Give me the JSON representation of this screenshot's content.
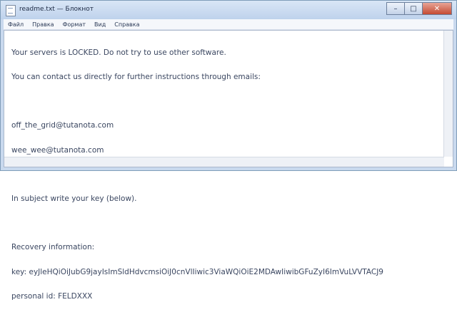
{
  "window": {
    "title": "readme.txt — Блокнот"
  },
  "menu": {
    "items": [
      "Файл",
      "Правка",
      "Формат",
      "Вид",
      "Справка"
    ]
  },
  "document": {
    "lines": [
      "Your servers is LOCKED. Do not try to use other software.",
      "You can contact us directly for further instructions through emails:",
      "",
      "off_the_grid@tutanota.com",
      "wee_wee@tutanota.com",
      "",
      "In subject write your key (below).",
      "",
      "Recovery information:",
      "key: eyJleHQiOiJubG9jayIsImSldHdvcmsiOiJ0cnVlIiwic3ViaWQiOiE2MDAwIiwibGFuZyI6ImVuLVVTACJ9",
      "personal id: FELDXXX"
    ]
  },
  "icons": {
    "app": "notepad-icon",
    "minimize": "minimize-icon",
    "maximize": "maximize-icon",
    "close": "close-icon"
  }
}
